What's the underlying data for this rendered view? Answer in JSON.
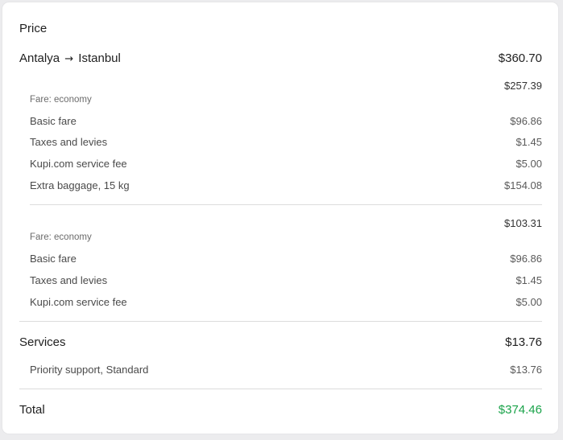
{
  "card": {
    "title": "Price",
    "flight": {
      "origin": "Antalya",
      "arrow": "→",
      "destination": "Istanbul",
      "amount": "$360.70",
      "segments": [
        {
          "amount": "$257.39",
          "fare_label": "Fare: economy",
          "items": [
            {
              "label": "Basic fare",
              "amount": "$96.86"
            },
            {
              "label": "Taxes and levies",
              "amount": "$1.45"
            },
            {
              "label": "Kupi.com service fee",
              "amount": "$5.00"
            },
            {
              "label": "Extra baggage, 15 kg",
              "amount": "$154.08"
            }
          ]
        },
        {
          "amount": "$103.31",
          "fare_label": "Fare: economy",
          "items": [
            {
              "label": "Basic fare",
              "amount": "$96.86"
            },
            {
              "label": "Taxes and levies",
              "amount": "$1.45"
            },
            {
              "label": "Kupi.com service fee",
              "amount": "$5.00"
            }
          ]
        }
      ]
    },
    "services": {
      "label": "Services",
      "amount": "$13.76",
      "items": [
        {
          "label": "Priority support, Standard",
          "amount": "$13.76"
        }
      ]
    },
    "total": {
      "label": "Total",
      "amount": "$374.46"
    }
  },
  "colors": {
    "total_amount": "#1aa34a",
    "background": "#ececee",
    "card": "#ffffff"
  }
}
